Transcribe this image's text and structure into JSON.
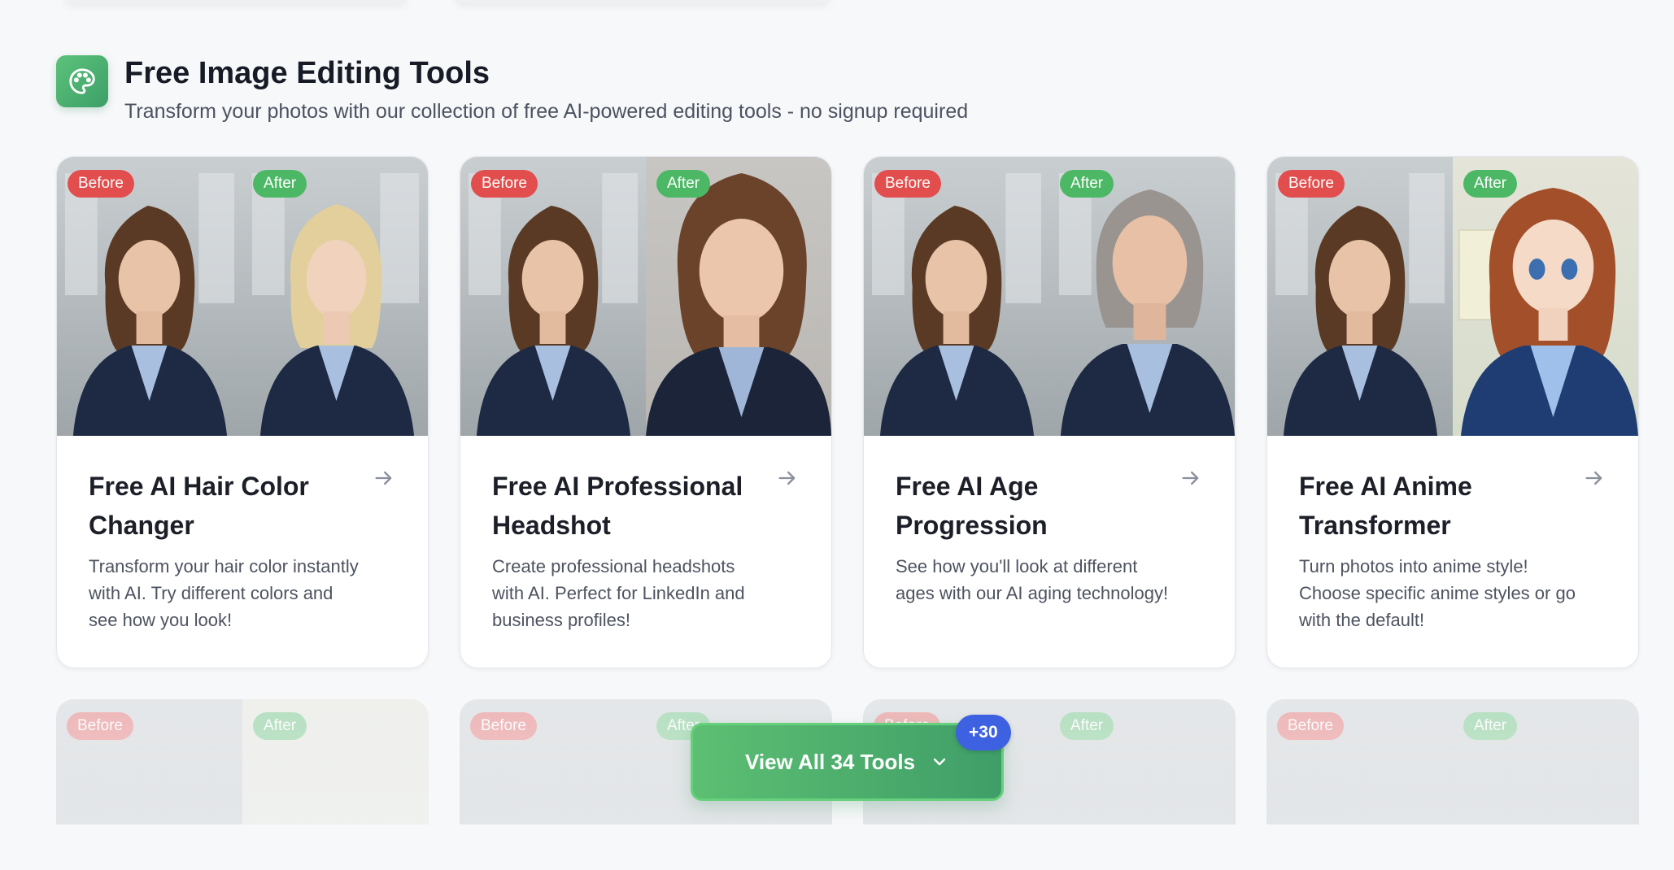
{
  "section": {
    "title": "Free Image Editing Tools",
    "subtitle": "Transform your photos with our collection of free AI-powered editing tools - no signup required",
    "icon": "palette-icon",
    "accent": "#4cb865"
  },
  "labels": {
    "before": "Before",
    "after": "After"
  },
  "tools": [
    {
      "title": "Free AI Hair Color Changer",
      "description": "Transform your hair color instantly with AI. Try different colors and see how you look!"
    },
    {
      "title": "Free AI Professional Headshot",
      "description": "Create professional headshots with AI. Perfect for LinkedIn and business profiles!"
    },
    {
      "title": "Free AI Age Progression",
      "description": "See how you'll look at different ages with our AI aging technology!"
    },
    {
      "title": "Free AI Anime Transformer",
      "description": "Turn photos into anime style! Choose specific anime styles or go with the default!"
    }
  ],
  "view_all": {
    "label": "View All 34 Tools",
    "badge": "+30"
  },
  "colors": {
    "before_badge": "#e24d4d",
    "after_badge": "#4cb865",
    "count_badge": "#3d61e0"
  }
}
